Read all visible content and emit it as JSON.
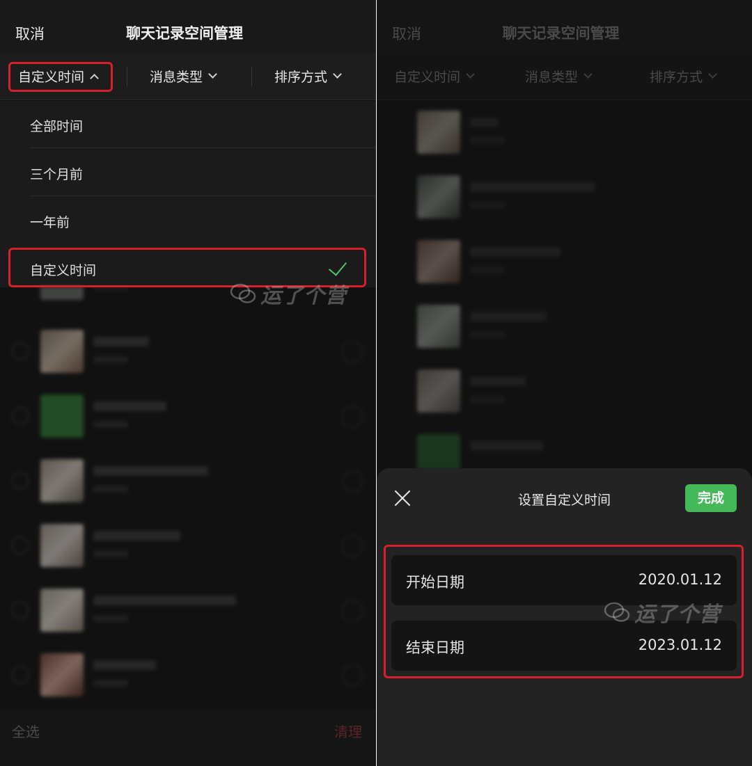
{
  "left": {
    "header": {
      "cancel": "取消",
      "title": "聊天记录空间管理"
    },
    "filters": [
      {
        "label": "自定义时间",
        "state": "open"
      },
      {
        "label": "消息类型",
        "state": "closed"
      },
      {
        "label": "排序方式",
        "state": "closed"
      }
    ],
    "dropdown": {
      "items": [
        {
          "label": "全部时间"
        },
        {
          "label": "三个月前"
        },
        {
          "label": "一年前"
        },
        {
          "label": "自定义时间",
          "selected": true
        }
      ]
    },
    "bottom": {
      "select_all": "全选",
      "clear": "清理"
    },
    "watermark": "运了个营"
  },
  "right": {
    "header": {
      "cancel": "取消",
      "title": "聊天记录空间管理"
    },
    "filters": [
      {
        "label": "自定义时间"
      },
      {
        "label": "消息类型"
      },
      {
        "label": "排序方式"
      }
    ],
    "sheet": {
      "title": "设置自定义时间",
      "done": "完成",
      "start_label": "开始日期",
      "start_value": "2020.01.12",
      "end_label": "结束日期",
      "end_value": "2023.01.12"
    },
    "watermark": "运了个营"
  },
  "colors": {
    "accent_green": "#45b95a",
    "highlight_red": "#d8202a",
    "background": "#111111"
  }
}
